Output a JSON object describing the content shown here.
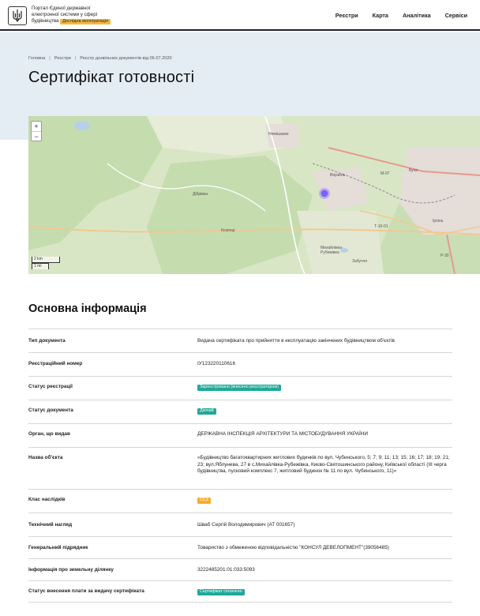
{
  "header": {
    "brand_line1": "Портал Єдиної державної",
    "brand_line2": "електронної системи у сфері",
    "brand_line3": "будівництва",
    "brand_badge": "Дослідна експлуатація",
    "nav": [
      "Реєстри",
      "Карта",
      "Аналітика",
      "Сервіси"
    ]
  },
  "breadcrumb": [
    "Головна",
    "Реєстри",
    "Реєстр дозвільних документів від 06.07.2020"
  ],
  "page_title": "Сертифікат готовності",
  "map": {
    "zoom_in": "+",
    "zoom_out": "−",
    "scale_km": "2 km",
    "scale_mi": "1 mi",
    "labels": [
      "Немішаєве",
      "Ворзель",
      "Буча",
      "Ірпінь",
      "Дібрівка",
      "Козинці",
      "Михайлівка-Рубежівка",
      "Забуччя",
      "М-07",
      "Т-10-01",
      "Р-30"
    ],
    "marker_color": "#7b61ff"
  },
  "section_title": "Основна інформація",
  "rows": [
    {
      "label": "Тип документа",
      "value": "Видача сертифіката про прийняття в експлуатацію закінчених будівництвом об'єктів"
    },
    {
      "label": "Реєстраційний номер",
      "value": "ІУ123220110616"
    },
    {
      "label": "Статус реєстрації",
      "value": "Зареєстровано (внесено реєстратором)",
      "pill": "teal"
    },
    {
      "label": "Статус документа",
      "value": "Діючий",
      "pill": "teal"
    },
    {
      "label": "Орган, що видав",
      "value": "ДЕРЖАВНА ІНСПЕКЦІЯ АРХІТЕКТУРИ ТА МІСТОБУДУВАННЯ УКРАЇНИ"
    },
    {
      "label": "Назва об'єкта",
      "value": "«Будівництво багатоквартирних житлових будинків по вул. Чубинського, 5; 7; 9; 11; 13; 15; 16; 17; 18; 19; 21; 23; вул.Яблунева, 27 в с.Михайлівка-Рубежівка, Києво-Святошинського району, Київської області (ІІІ черга будівництва, пусковий комплекс 7, житловий будинок № 11 по вул. Чубинського, 11)»"
    },
    {
      "label": "Клас наслідків",
      "value": "СС3",
      "pill": "amber"
    },
    {
      "label": "Технічний нагляд",
      "value": "Шваб Сергій Володимирович (АТ 001657)"
    },
    {
      "label": "Генеральний підрядник",
      "value": "Товариство з обмеженою відповідальністю \"КОНСУЛ ДЕВЕЛОПМЕНТ\"(39056485)"
    },
    {
      "label": "Інформація про земельну ділянку",
      "value": "3222485201:01:033:5093"
    },
    {
      "label": "Статус внесення плати за видачу сертифіката",
      "value": "Сертифікат сплачено",
      "pill": "teal"
    }
  ]
}
